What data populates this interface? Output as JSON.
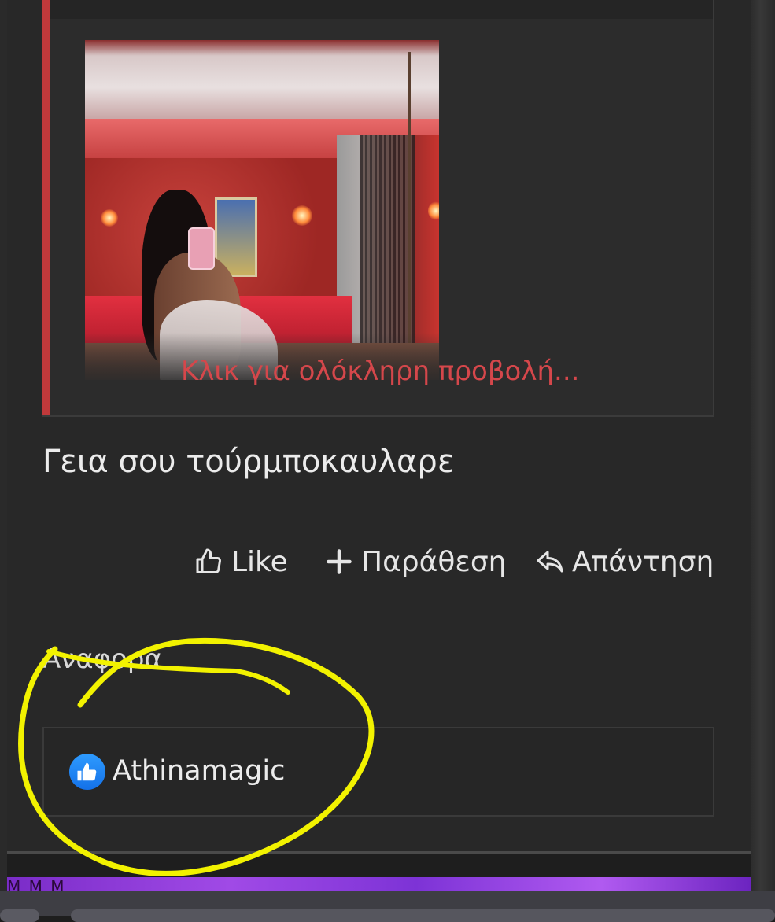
{
  "quote": {
    "expand_label": "Κλικ για ολόκληρη προβολή..."
  },
  "post": {
    "body": "Γεια σου τούρμποκαυλαρε"
  },
  "actions": {
    "like": "Like",
    "quote": "Παράθεση",
    "reply": "Απάντηση"
  },
  "report": "Αναφορά",
  "reactions": {
    "user": "Athinamagic"
  },
  "banner": {
    "text": "Μ   Μ   Μ"
  },
  "colors": {
    "accent_red": "#c0393b",
    "link_red": "#d5474b",
    "like_blue": "#1877f2",
    "annotation_yellow": "#f5f500"
  }
}
